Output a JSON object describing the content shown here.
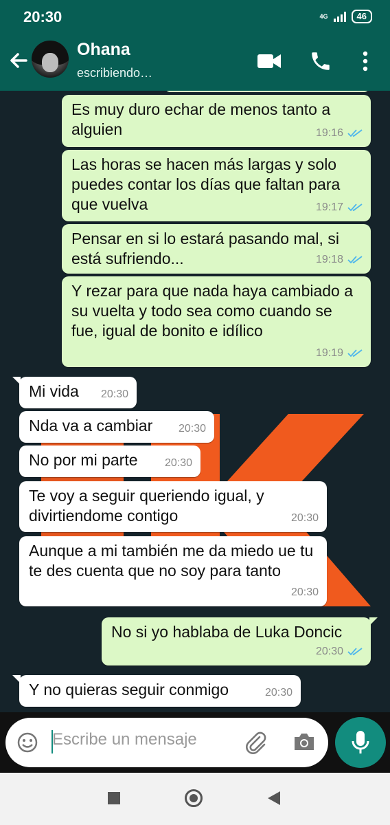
{
  "status": {
    "time": "20:30",
    "network": "4G",
    "battery": "46"
  },
  "header": {
    "contact_name": "Ohana",
    "contact_status": "escribiendo…"
  },
  "icons": {
    "back": "arrow-left-icon",
    "video": "video-call-icon",
    "call": "phone-icon",
    "menu": "more-vert-icon",
    "emoji": "emoji-icon",
    "attach": "paperclip-icon",
    "camera": "camera-icon",
    "mic": "mic-icon"
  },
  "messages": [
    {
      "dir": "out",
      "text": "Es muy duro echar de menos tanto a alguien",
      "time": "19:16",
      "read": true
    },
    {
      "dir": "out",
      "text": "Las horas se hacen más largas y solo puedes contar los días que faltan para que vuelva",
      "time": "19:17",
      "read": true
    },
    {
      "dir": "out",
      "text": "Pensar en si lo estará pasando mal, si está sufriendo...",
      "time": "19:18",
      "read": true
    },
    {
      "dir": "out",
      "text": "Y rezar para que nada haya cambiado a su vuelta y todo sea como cuando se fue, igual de bonito e idílico",
      "time": "19:19",
      "read": true
    },
    {
      "dir": "in",
      "text": "Mi vida",
      "time": "20:30"
    },
    {
      "dir": "in",
      "text": "Nda va a cambiar",
      "time": "20:30"
    },
    {
      "dir": "in",
      "text": "No por mi parte",
      "time": "20:30"
    },
    {
      "dir": "in",
      "text": "Te voy a seguir queriendo igual, y divirtiendome contigo",
      "time": "20:30"
    },
    {
      "dir": "in",
      "text": "Aunque a mi también me da miedo ue tu te des cuenta que no soy para tanto",
      "time": "20:30"
    },
    {
      "dir": "out",
      "text": "No si yo hablaba de Luka Doncic",
      "time": "20:30",
      "read": true
    },
    {
      "dir": "in",
      "text": "Y no quieras seguir conmigo",
      "time": "20:30"
    }
  ],
  "composer": {
    "placeholder": "Escribe un mensaje"
  },
  "colors": {
    "header": "#075e54",
    "accent": "#128c7e",
    "outgoing": "#dcf8c6",
    "incoming": "#ffffff",
    "read_tick": "#4fb6ec",
    "wallpaper_mark": "#f05a1e"
  }
}
